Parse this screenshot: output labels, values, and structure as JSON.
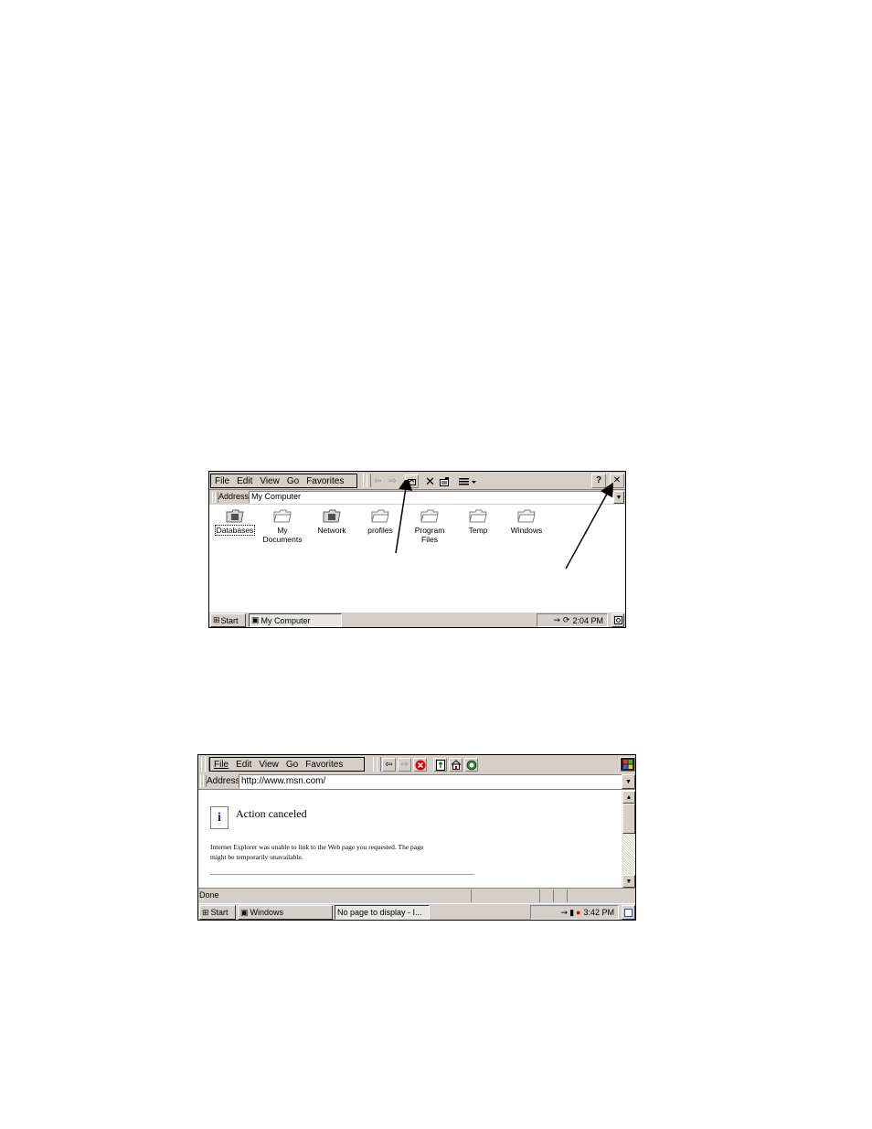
{
  "explorer": {
    "menu": [
      "File",
      "Edit",
      "View",
      "Go",
      "Favorites"
    ],
    "help_button": "?",
    "close_button": "✕",
    "address_label": "Address",
    "address_value": "My Computer",
    "items": [
      {
        "label": "Databases",
        "icon": "database-icon"
      },
      {
        "label": "My\nDocuments",
        "icon": "folder-icon"
      },
      {
        "label": "Network",
        "icon": "network-icon"
      },
      {
        "label": "profiles",
        "icon": "folder-icon"
      },
      {
        "label": "Program Files",
        "icon": "folder-icon"
      },
      {
        "label": "Temp",
        "icon": "folder-icon"
      },
      {
        "label": "Windows",
        "icon": "folder-icon"
      }
    ],
    "taskbar": {
      "start": "Start",
      "window": "My Computer",
      "clock": "2:04 PM"
    }
  },
  "browser": {
    "menu": [
      "File",
      "Edit",
      "View",
      "Go",
      "Favorites"
    ],
    "address_label": "Address",
    "address_value": "http://www.msn.com/",
    "title": "Action canceled",
    "message_line1": "Internet Explorer was unable to link to the Web page you requested. The page",
    "message_line2": "might be temporarily unavailable.",
    "status": "Done",
    "taskbar": {
      "start": "Start",
      "window1": "Windows",
      "window2": "No page to display - I...",
      "clock": "3:42 PM"
    }
  }
}
